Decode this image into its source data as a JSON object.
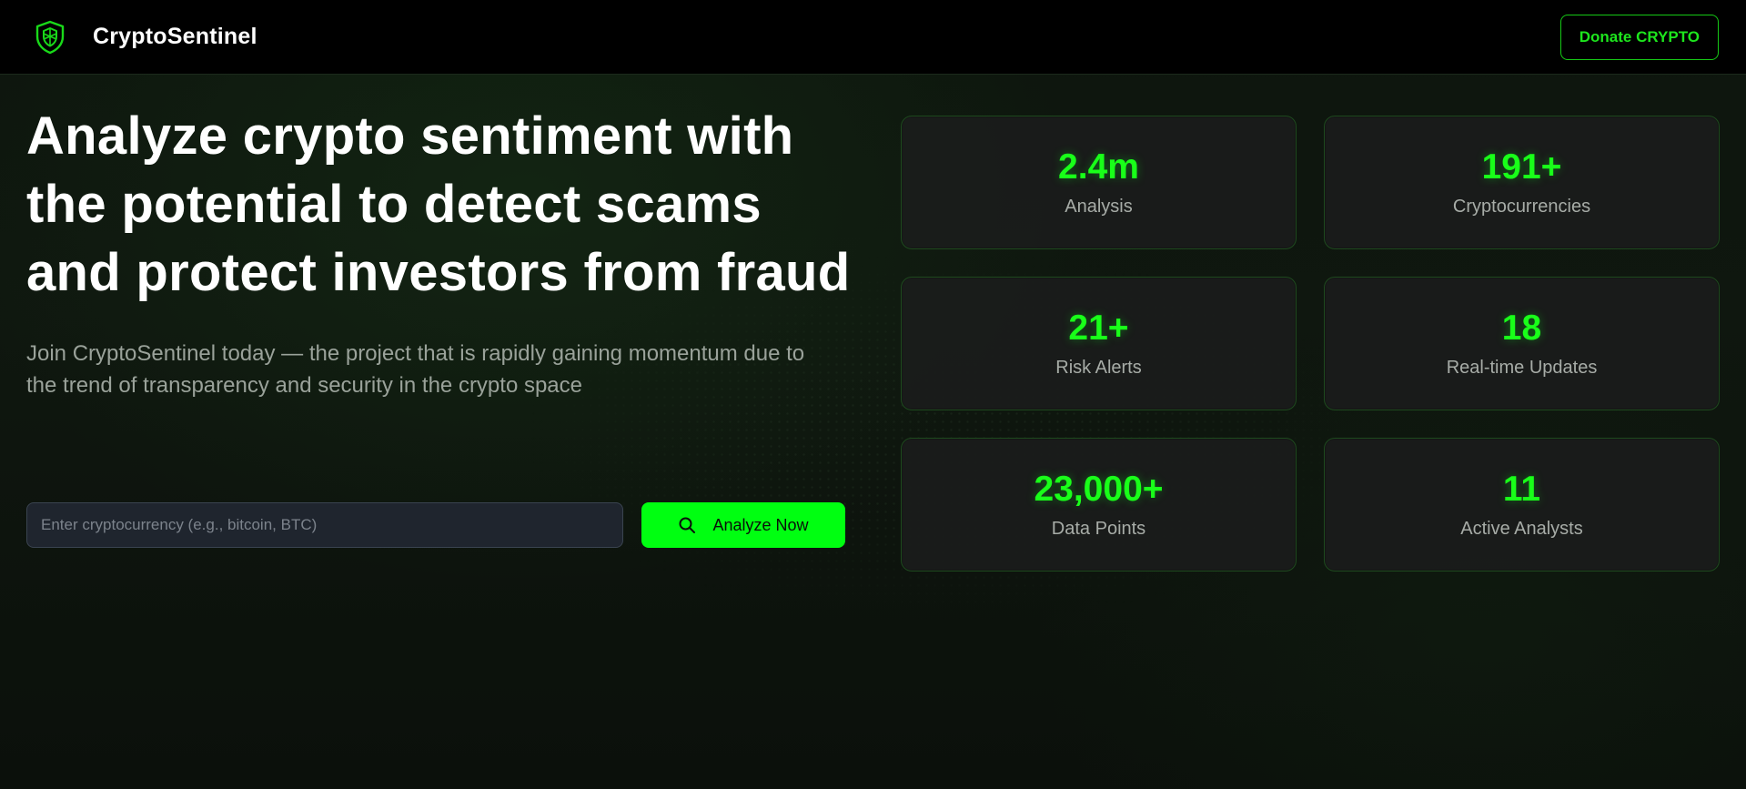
{
  "header": {
    "brand_name": "CryptoSentinel",
    "logo_icon": "shield-icon",
    "donate_label": "Donate CRYPTO"
  },
  "hero": {
    "title": "Analyze crypto sentiment with the potential to detect scams and protect investors from fraud",
    "subtitle": "Join CryptoSentinel today — the project that is rapidly gaining momentum due to the trend of transparency and security in the crypto space"
  },
  "search": {
    "placeholder": "Enter cryptocurrency (e.g., bitcoin, BTC)",
    "value": "",
    "button_label": "Analyze Now",
    "button_icon": "search-icon"
  },
  "stats": [
    {
      "value": "2.4m",
      "label": "Analysis"
    },
    {
      "value": "191+",
      "label": "Cryptocurrencies"
    },
    {
      "value": "21+",
      "label": "Risk Alerts"
    },
    {
      "value": "18",
      "label": "Real-time Updates"
    },
    {
      "value": "23,000+",
      "label": "Data Points"
    },
    {
      "value": "11",
      "label": "Active Analysts"
    }
  ],
  "colors": {
    "accent": "#00ff11",
    "background": "#0b100b",
    "header_bg": "#000000",
    "card_bg": "#1a1c1b",
    "card_border": "#1e4a1e",
    "text_primary": "#ffffff",
    "text_muted": "#9aa29a"
  }
}
